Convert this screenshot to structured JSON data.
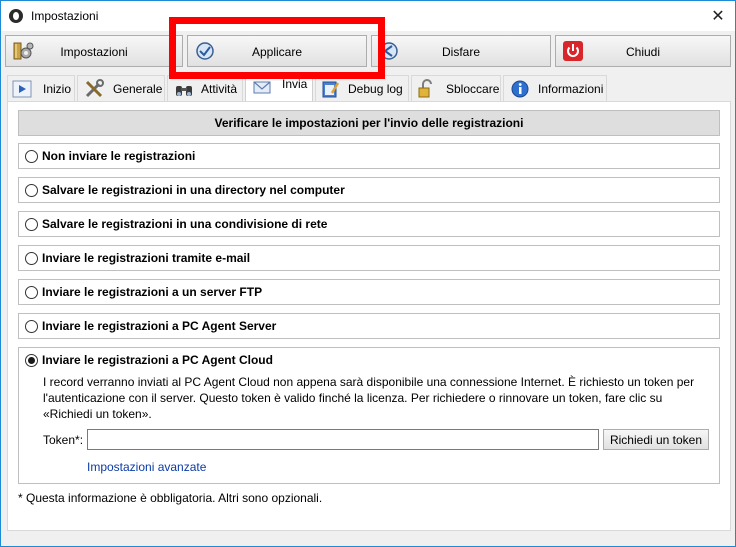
{
  "window": {
    "title": "Impostazioni",
    "close_label": "✕"
  },
  "toolbar": {
    "settings_label": "Impostazioni",
    "apply_label": "Applicare",
    "undo_label": "Disfare",
    "close_label": "Chiudi"
  },
  "tabs": [
    {
      "label": "Inizio",
      "icon": "play-icon"
    },
    {
      "label": "Generale",
      "icon": "tools-icon"
    },
    {
      "label": "Attività",
      "icon": "binoculars-icon"
    },
    {
      "label": "Invia",
      "icon": "mail-icon"
    },
    {
      "label": "Debug log",
      "icon": "notepad-icon"
    },
    {
      "label": "Sbloccare",
      "icon": "padlock-icon"
    },
    {
      "label": "Informazioni",
      "icon": "info-icon"
    }
  ],
  "active_tab": "Invia",
  "panel": {
    "header": "Verificare le impostazioni per l'invio delle registrazioni",
    "options": [
      {
        "label": "Non inviare le registrazioni",
        "checked": false
      },
      {
        "label": "Salvare le registrazioni in una directory nel computer",
        "checked": false
      },
      {
        "label": "Salvare le registrazioni in una condivisione di rete",
        "checked": false
      },
      {
        "label": "Inviare le registrazioni tramite e-mail",
        "checked": false
      },
      {
        "label": "Inviare le registrazioni a un server FTP",
        "checked": false
      },
      {
        "label": "Inviare le registrazioni a PC Agent Server",
        "checked": false
      }
    ],
    "cloud": {
      "label": "Inviare le registrazioni a PC Agent Cloud",
      "checked": true,
      "description": "I record verranno inviati al PC Agent Cloud non appena sarà disponibile una connessione Internet. È richiesto un token per l'autenticazione con il server. Questo token è valido finché la licenza. Per richiedere o rinnovare un token, fare clic su «Richiedi un token».",
      "token_label": "Token*:",
      "token_value": "",
      "token_button": "Richiedi un token",
      "advanced_link": "Impostazioni avanzate"
    },
    "footnote": "* Questa informazione è obbligatoria. Altri sono opzionali."
  },
  "colors": {
    "accent_border": "#1e8ad6",
    "highlight": "#ff0000",
    "link": "#0b3ba8",
    "close_button_red": "#d9262a"
  }
}
